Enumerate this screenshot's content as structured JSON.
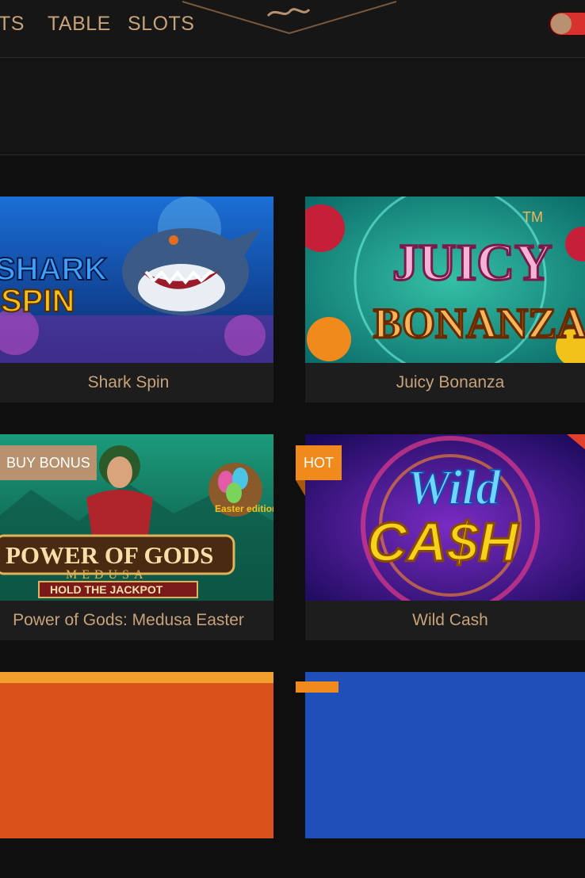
{
  "header": {
    "nav": [
      "TS",
      "TABLE",
      "SLOTS"
    ],
    "toggle_on": true
  },
  "games": [
    {
      "title": "Shark Spin",
      "art_title": "SHARK SPIN",
      "badge": null
    },
    {
      "title": "Juicy Bonanza",
      "art_title": "JUICY BONANZA",
      "badge": null
    },
    {
      "title": "Power of Gods: Medusa Easter",
      "art_title": "POWER OF GODS MEDUSA",
      "art_sub": "HOLD THE JACKPOT",
      "art_extra": "Easter edition",
      "badge": "BUY BONUS"
    },
    {
      "title": "Wild Cash",
      "art_title": "Wild CASH",
      "badge": "HOT"
    }
  ],
  "colors": {
    "accent": "#c8a27a",
    "background": "#0f0f0f",
    "caption_bg": "#1d1d1d",
    "toggle": "#d8322e",
    "hot": "#f08a1d",
    "buy_bonus": "#b8926f"
  }
}
